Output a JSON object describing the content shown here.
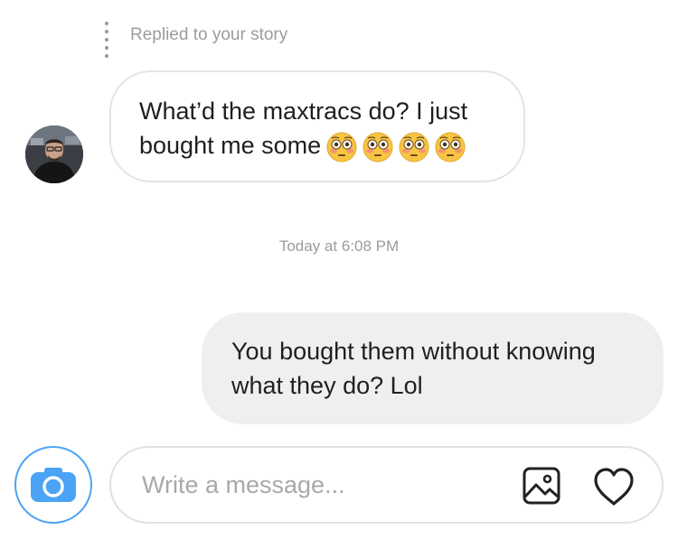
{
  "thread": {
    "story_reply_label": "Replied to your story",
    "incoming": {
      "line1": "What’d the maxtracs do? I just",
      "line2": "bought me some",
      "emojis": [
        "flushed-face",
        "flushed-face",
        "flushed-face",
        "flushed-face"
      ]
    },
    "timestamp": "Today at 6:08 PM",
    "outgoing": {
      "line1": "You bought them without knowing",
      "line2": "what they do? Lol"
    }
  },
  "composer": {
    "placeholder": "Write a message...",
    "value": "",
    "icons": {
      "camera": "camera-icon",
      "gallery": "image-icon",
      "like": "heart-icon"
    }
  },
  "colors": {
    "accent": "#3897f0",
    "camera_fill": "#4aa3f5",
    "outgoing_bubble": "#efefef",
    "incoming_border": "#e4e4e4",
    "secondary_text": "#9c9c9c"
  }
}
